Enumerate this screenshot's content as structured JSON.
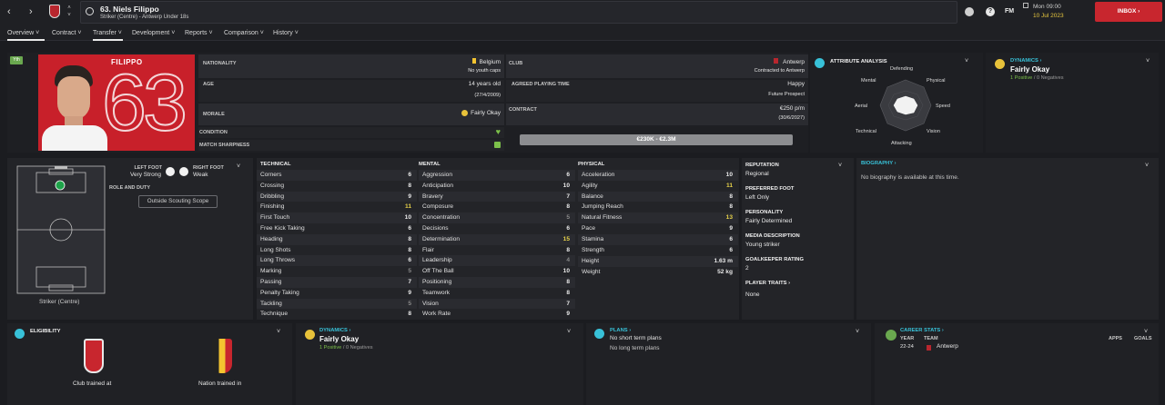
{
  "topbar": {
    "player_title": "63. Niels Filippo",
    "player_sub": "Striker (Centre) - Antwerp Under 18s",
    "fm_label": "FM",
    "date_day": "Mon 09:00",
    "date": "10 Jul 2023",
    "inbox_label": "INBOX"
  },
  "nav": {
    "tabs": [
      "Overview",
      "Contract",
      "Transfer",
      "Development",
      "Reports",
      "Comparison",
      "History"
    ]
  },
  "profile": {
    "yth_badge": "Yth",
    "shirt_name": "FILIPPO",
    "shirt_number": "63",
    "nationality_label": "NATIONALITY",
    "nationality": "Belgium",
    "youth_caps": "No youth caps",
    "age_label": "AGE",
    "age": "14 years old",
    "dob": "(27/4/2009)",
    "morale_label": "MORALE",
    "morale": "Fairly Okay",
    "condition_label": "CONDITION",
    "sharpness_label": "MATCH SHARPNESS",
    "club_label": "CLUB",
    "club": "Antwerp",
    "club_sub": "Contracted to Antwerp",
    "playing_time_label": "AGREED PLAYING TIME",
    "playing_time": "Happy",
    "playing_time_sub": "Future Prospect",
    "contract_label": "CONTRACT",
    "wage": "€250 p/m",
    "contract_end": "(30/6/2027)",
    "value_range": "€230K - €2.3M"
  },
  "attr_analysis": {
    "title": "ATTRIBUTE ANALYSIS",
    "labels": [
      "Defending",
      "Physical",
      "Speed",
      "Vision",
      "Attacking",
      "Technical",
      "Aerial",
      "Mental"
    ]
  },
  "dynamics_top": {
    "title": "DYNAMICS",
    "value": "Fairly Okay",
    "positives": "1 Positive",
    "negatives": "0 Negatives",
    "sep": "/"
  },
  "pitch": {
    "left_foot_label": "LEFT FOOT",
    "left_foot": "Very Strong",
    "right_foot_label": "RIGHT FOOT",
    "right_foot": "Weak",
    "role_label": "ROLE AND DUTY",
    "scouting_btn": "Outside Scouting Scope",
    "position": "Striker (Centre)"
  },
  "technical": {
    "title": "TECHNICAL",
    "rows": [
      {
        "n": "Corners",
        "v": "6"
      },
      {
        "n": "Crossing",
        "v": "8"
      },
      {
        "n": "Dribbling",
        "v": "9"
      },
      {
        "n": "Finishing",
        "v": "11"
      },
      {
        "n": "First Touch",
        "v": "10"
      },
      {
        "n": "Free Kick Taking",
        "v": "6"
      },
      {
        "n": "Heading",
        "v": "8"
      },
      {
        "n": "Long Shots",
        "v": "8"
      },
      {
        "n": "Long Throws",
        "v": "6"
      },
      {
        "n": "Marking",
        "v": "5"
      },
      {
        "n": "Passing",
        "v": "7"
      },
      {
        "n": "Penalty Taking",
        "v": "9"
      },
      {
        "n": "Tackling",
        "v": "5"
      },
      {
        "n": "Technique",
        "v": "8"
      }
    ]
  },
  "mental": {
    "title": "MENTAL",
    "rows": [
      {
        "n": "Aggression",
        "v": "6"
      },
      {
        "n": "Anticipation",
        "v": "10"
      },
      {
        "n": "Bravery",
        "v": "7"
      },
      {
        "n": "Composure",
        "v": "8"
      },
      {
        "n": "Concentration",
        "v": "5"
      },
      {
        "n": "Decisions",
        "v": "6"
      },
      {
        "n": "Determination",
        "v": "15"
      },
      {
        "n": "Flair",
        "v": "8"
      },
      {
        "n": "Leadership",
        "v": "4"
      },
      {
        "n": "Off The Ball",
        "v": "10"
      },
      {
        "n": "Positioning",
        "v": "8"
      },
      {
        "n": "Teamwork",
        "v": "8"
      },
      {
        "n": "Vision",
        "v": "7"
      },
      {
        "n": "Work Rate",
        "v": "9"
      }
    ]
  },
  "physical": {
    "title": "PHYSICAL",
    "rows": [
      {
        "n": "Acceleration",
        "v": "10"
      },
      {
        "n": "Agility",
        "v": "11"
      },
      {
        "n": "Balance",
        "v": "8"
      },
      {
        "n": "Jumping Reach",
        "v": "8"
      },
      {
        "n": "Natural Fitness",
        "v": "13"
      },
      {
        "n": "Pace",
        "v": "9"
      },
      {
        "n": "Stamina",
        "v": "6"
      },
      {
        "n": "Strength",
        "v": "6"
      }
    ],
    "height_label": "Height",
    "height": "1.63 m",
    "weight_label": "Weight",
    "weight": "52 kg"
  },
  "info": {
    "reputation_label": "REPUTATION",
    "reputation": "Regional",
    "pref_foot_label": "PREFERRED FOOT",
    "pref_foot": "Left Only",
    "personality_label": "PERSONALITY",
    "personality": "Fairly Determined",
    "media_label": "MEDIA DESCRIPTION",
    "media": "Young striker",
    "gk_label": "GOALKEEPER RATING",
    "gk": "2",
    "traits_label": "PLAYER TRAITS",
    "traits": "None"
  },
  "biography": {
    "title": "BIOGRAPHY",
    "text": "No biography is available at this time."
  },
  "eligibility": {
    "title": "ELIGIBILITY",
    "club_trained": "Club trained at",
    "nation_trained": "Nation trained in"
  },
  "dynamics_bottom": {
    "title": "DYNAMICS",
    "value": "Fairly Okay",
    "positives": "1 Positive",
    "negatives": "0 Negatives",
    "sep": "/"
  },
  "plans": {
    "title": "PLANS",
    "short": "No short term plans",
    "long": "No long term plans"
  },
  "career": {
    "title": "CAREER STATS",
    "year_col": "YEAR",
    "team_col": "TEAM",
    "apps_col": "APPS",
    "goals_col": "GOALS",
    "year": "22-24",
    "team": "Antwerp"
  },
  "colors": {
    "accent_cyan": "#38c1d8",
    "inbox_red": "#c8262e",
    "shirt_red": "#c8202a",
    "positive_green": "#7cc04a",
    "highlight_yellow": "#e8d34a"
  },
  "icons": [
    "back-arrow-icon",
    "forward-arrow-icon",
    "club-crest-icon",
    "search-icon",
    "help-icon",
    "chevron-down-icon",
    "morale-face-icon",
    "heart-icon",
    "sharpness-icon",
    "foot-icon"
  ]
}
